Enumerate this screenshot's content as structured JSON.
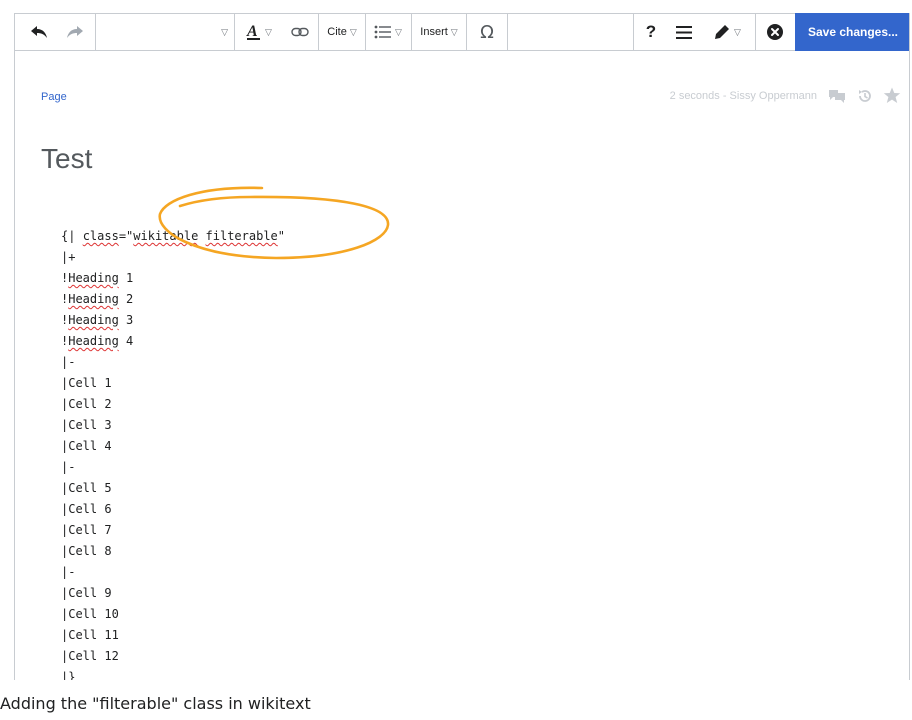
{
  "toolbar": {
    "cite_label": "Cite",
    "insert_label": "Insert",
    "help_label": "?",
    "save_label": "Save changes..."
  },
  "page_meta": {
    "page_link": "Page",
    "edit_info": "2 seconds - Sissy Oppermann"
  },
  "title": "Test",
  "code": {
    "line0_prefix": "{| ",
    "line0_word1": "class",
    "line0_mid": "=\"",
    "line0_word2": "wikitable",
    "line0_space": " ",
    "line0_word3": "filterable",
    "line0_end": "\"",
    "line1": "|+",
    "heading_prefix": "!",
    "heading_word": "Heading",
    "heading_nums": [
      " 1",
      " 2",
      " 3",
      " 4"
    ],
    "row_sep": "|-",
    "cells": [
      "|Cell 1",
      "|Cell 2",
      "|Cell 3",
      "|Cell 4",
      "|Cell 5",
      "|Cell 6",
      "|Cell 7",
      "|Cell 8",
      "|Cell 9",
      "|Cell 10",
      "|Cell 11",
      "|Cell 12"
    ],
    "end": "|}"
  },
  "highlight_color": "#f5a623",
  "accent_color": "#3366cc",
  "caption": "Adding the \"filterable\" class in wikitext"
}
